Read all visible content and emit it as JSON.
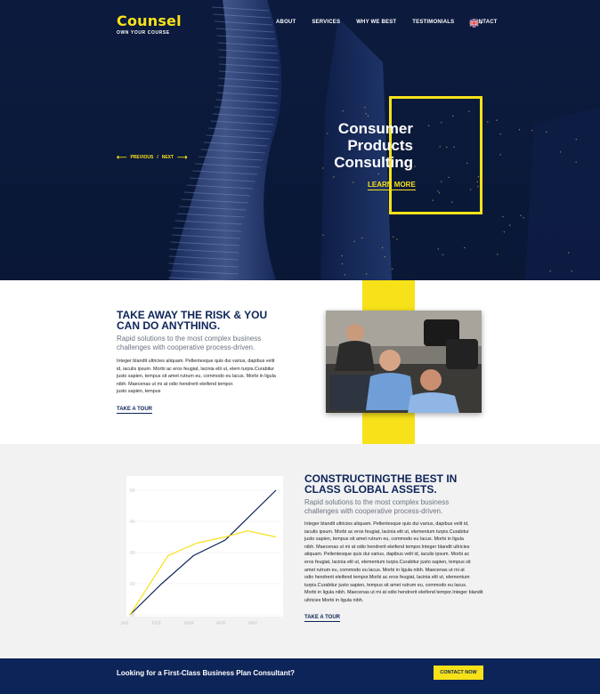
{
  "brand": {
    "name": "Counsel",
    "tagline": "OWN YOUR COURSE",
    "accent": "#f7e21a",
    "navy": "#0d2458"
  },
  "nav": {
    "items": [
      {
        "label": "ABOUT"
      },
      {
        "label": "SERVICES"
      },
      {
        "label": "WHY WE BEST"
      },
      {
        "label": "TESTIMONIALS"
      },
      {
        "label": "CONTACT"
      }
    ],
    "language_icon": "uk-flag-icon"
  },
  "hero": {
    "prev": "PREVIOUS",
    "separator": "/",
    "next": "NEXT",
    "title_line1": "Consumer",
    "title_line2": "Products",
    "title_line3": "Consulting",
    "cta": "LEARN MORE"
  },
  "section_risk": {
    "heading_line1": "TAKE AWAY THE RISK & YOU",
    "heading_line2": "CAN DO ANYTHING.",
    "lead_line1": "Rapid solutions to the most complex business",
    "lead_line2": "challenges with cooperative process-driven.",
    "body_lines": [
      "Integer blandit ultricies aliquam. Pellentesque quis dui varius, dapibus velit",
      "id, iaculis ipsum. Morbi ac eros feugiat, lacinia elit ut, elem turpis.Curabitur",
      "justo sapien, tempus sit amet rutrum eu, commodo eu lacus. Morbi in ligula",
      "nibh. Maecenas ut mi at odio hendrerit eleifend tempor.",
      "justo sapien, tempus"
    ],
    "cta": "TAKE A TOUR"
  },
  "section_assets": {
    "heading_line1": "CONSTRUCTINGTHE  BEST IN",
    "heading_line2": "CLASS GLOBAL ASSETS.",
    "lead_line1": "Rapid solutions to the most complex business",
    "lead_line2": "challenges with cooperative process-driven.",
    "body_lines": [
      "Integer blandit ultricies aliquam. Pellentesque quis dui varius, dapibus velit id,",
      "iaculis ipsum. Morbi ac eros feugiat, lacinia elit ut, elementum turpis.Curabitur",
      "justo sapien, tempus sit amet rutrum eu, commodo eu lacus. Morbi in ligula",
      "nibh. Maecenas ut mi at odio hendrerit eleifend tempor.Integer blandit ultricies",
      "aliquam. Pellentesque quis dui varius, dapibus velit id, iaculis ipsum. Morbi ac",
      "eros feugiat, lacinia elit ut, elementum turpis.Curabitur justo sapien, tempus sit",
      "amet rutrum eu, commodo eu lacus. Morbi in ligula nibh. Maecenas ut mi at",
      "odio hendrerit eleifend tempor.Morbi ac eros feugiat, lacinia elit ut, elementum",
      "turpis.Curabitur justo sapien, tempus sit amet rutrum eu, commodo eu lacus.",
      "Morbi in ligula nibh. Maecenas ut mi at odio hendrerit eleifend tempor.Integer blandit",
      "ultricies Morbi in ligula nibh."
    ],
    "cta": "TAKE A TOUR"
  },
  "chart_data": {
    "type": "line",
    "categories": [
      "JAN",
      "FEB",
      "MAR",
      "APR",
      "MAY"
    ],
    "series": [
      {
        "color": "#0d2458",
        "x": [
          0,
          1,
          2,
          3,
          4.6
        ],
        "values": [
          10,
          20,
          29,
          34,
          50
        ]
      },
      {
        "color": "#f7e21a",
        "x": [
          0,
          1.2,
          2.1,
          3,
          3.7,
          4.6
        ],
        "values": [
          10,
          29,
          33,
          35,
          37,
          35
        ]
      }
    ],
    "yticks": [
      10,
      20,
      30,
      40,
      50
    ],
    "ylim": [
      10,
      50
    ],
    "grid": true,
    "legend": "none"
  },
  "footer": {
    "text": "Looking for a First-Class Business Plan Consultant?",
    "cta": "CONTACT NOW"
  }
}
